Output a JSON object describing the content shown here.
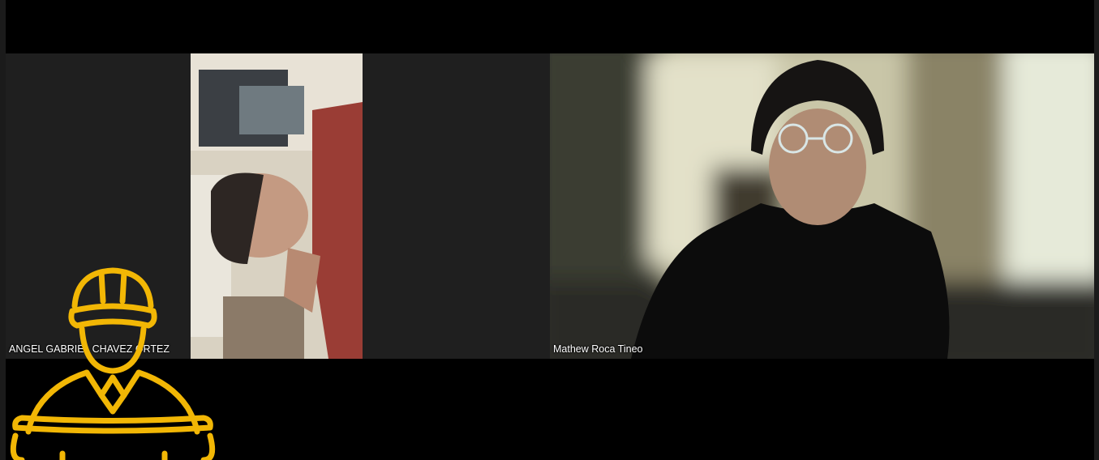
{
  "meeting": {
    "participants": [
      {
        "name": "ANGEL GABRIEL CHAVEZ ORTEZ"
      },
      {
        "name": "Mathew Roca Tineo"
      }
    ]
  },
  "colors": {
    "background": "#000000",
    "tile_background": "#1f1f1f",
    "label_text": "#ffffff",
    "logo_accent": "#f2b705"
  },
  "icons": {
    "logo": "construction-worker-icon"
  }
}
